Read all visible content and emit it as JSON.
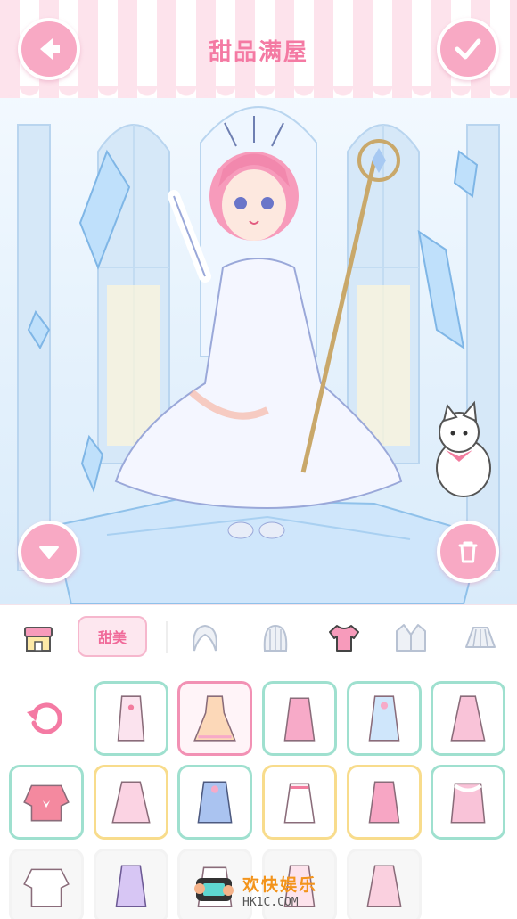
{
  "header": {
    "title": "甜品满屋",
    "back_icon": "arrow-left-icon",
    "confirm_icon": "check-icon"
  },
  "scene": {
    "collapse_icon": "triangle-down-icon",
    "delete_icon": "trash-icon"
  },
  "categories": {
    "active_tab_label": "甜美",
    "items": [
      {
        "name": "shop-icon"
      },
      {
        "name": "hair-front-icon"
      },
      {
        "name": "hair-back-icon"
      },
      {
        "name": "top-icon",
        "active": true
      },
      {
        "name": "jacket-icon"
      },
      {
        "name": "skirt-icon"
      }
    ]
  },
  "items": {
    "reset_icon": "undo-icon",
    "selected_index": 1
  },
  "watermark": {
    "main": "欢快娱乐",
    "sub": "HK1C.COM"
  },
  "colors": {
    "accent_pink": "#f8a9c4",
    "title_pink": "#f47aa3",
    "mint_border": "#9fe0cf",
    "gold_border": "#f8dc8c"
  }
}
